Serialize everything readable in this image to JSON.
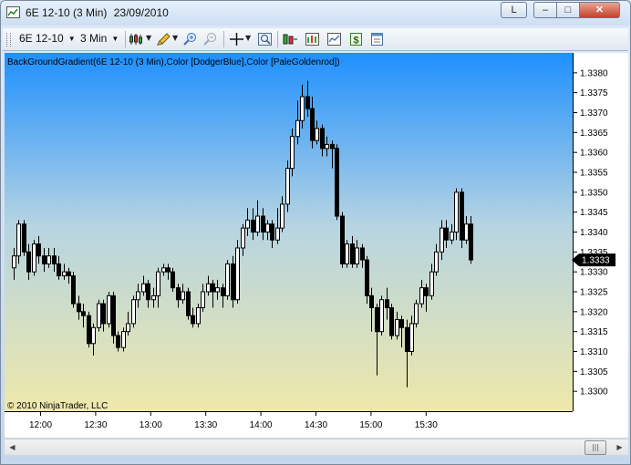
{
  "window": {
    "title_instrument": "6E 12-10",
    "title_period": "(3 Min)",
    "title_date": "23/09/2010",
    "btn_l": "L",
    "btn_min": "–",
    "btn_max": "□",
    "btn_close": "✕"
  },
  "toolbar": {
    "instrument": "6E 12-10",
    "period": "3 Min"
  },
  "chart": {
    "indicator_label": "BackGroundGradient(6E 12-10 (3 Min),Color [DodgerBlue],Color [PaleGoldenrod])",
    "copyright": "© 2010 NinjaTrader, LLC",
    "last_price_label": "1.3333",
    "gradient_top": "#1e90ff",
    "gradient_bottom": "#eee8aa"
  },
  "scrollbar": {
    "left_arrow": "◀",
    "right_arrow": "▶",
    "thumb_grip": "|||"
  },
  "chart_data": {
    "type": "candlestick",
    "ylim": [
      1.3295,
      1.3385
    ],
    "y_ticks": [
      "1.3380",
      "1.3375",
      "1.3370",
      "1.3365",
      "1.3360",
      "1.3355",
      "1.3350",
      "1.3345",
      "1.3340",
      "1.3335",
      "1.3330",
      "1.3325",
      "1.3320",
      "1.3315",
      "1.3310",
      "1.3305",
      "1.3300"
    ],
    "x_ticks": [
      "12:00",
      "12:30",
      "13:00",
      "13:30",
      "14:00",
      "14:30",
      "15:00",
      "15:30"
    ],
    "last_price": 1.3333,
    "candles": [
      [
        1.3331,
        1.3334,
        1.3328,
        1.3336
      ],
      [
        1.3334,
        1.3342,
        1.3332,
        1.3343
      ],
      [
        1.3342,
        1.3335,
        1.3334,
        1.3343
      ],
      [
        1.3335,
        1.333,
        1.3328,
        1.3337
      ],
      [
        1.333,
        1.3337,
        1.3329,
        1.3338
      ],
      [
        1.3337,
        1.3334,
        1.3332,
        1.3339
      ],
      [
        1.3334,
        1.3332,
        1.333,
        1.3336
      ],
      [
        1.3332,
        1.3334,
        1.3331,
        1.3336
      ],
      [
        1.3334,
        1.3332,
        1.333,
        1.3336
      ],
      [
        1.3332,
        1.3329,
        1.3328,
        1.3334
      ],
      [
        1.3329,
        1.333,
        1.3328,
        1.3332
      ],
      [
        1.333,
        1.3329,
        1.3327,
        1.3331
      ],
      [
        1.3329,
        1.3322,
        1.3321,
        1.333
      ],
      [
        1.3322,
        1.332,
        1.3318,
        1.3324
      ],
      [
        1.332,
        1.3319,
        1.3316,
        1.3322
      ],
      [
        1.3319,
        1.3312,
        1.3311,
        1.332
      ],
      [
        1.3312,
        1.3316,
        1.3309,
        1.3317
      ],
      [
        1.3316,
        1.3322,
        1.3315,
        1.3323
      ],
      [
        1.3322,
        1.3317,
        1.3315,
        1.3323
      ],
      [
        1.3317,
        1.3324,
        1.3316,
        1.3325
      ],
      [
        1.3324,
        1.3314,
        1.3312,
        1.3325
      ],
      [
        1.3314,
        1.3311,
        1.331,
        1.3315
      ],
      [
        1.3311,
        1.3315,
        1.331,
        1.3316
      ],
      [
        1.3315,
        1.3317,
        1.3314,
        1.332
      ],
      [
        1.3317,
        1.3323,
        1.3316,
        1.3324
      ],
      [
        1.3323,
        1.3325,
        1.3321,
        1.3327
      ],
      [
        1.3325,
        1.3327,
        1.3324,
        1.3329
      ],
      [
        1.3327,
        1.3323,
        1.3321,
        1.3328
      ],
      [
        1.3323,
        1.3324,
        1.3321,
        1.3326
      ],
      [
        1.3324,
        1.333,
        1.3321,
        1.3331
      ],
      [
        1.333,
        1.3331,
        1.3329,
        1.3332
      ],
      [
        1.3331,
        1.333,
        1.3328,
        1.3332
      ],
      [
        1.333,
        1.3326,
        1.3325,
        1.3331
      ],
      [
        1.3326,
        1.3323,
        1.3321,
        1.3327
      ],
      [
        1.3323,
        1.3325,
        1.3322,
        1.3327
      ],
      [
        1.3325,
        1.3319,
        1.3318,
        1.3326
      ],
      [
        1.3319,
        1.3317,
        1.3316,
        1.3321
      ],
      [
        1.3317,
        1.3321,
        1.3316,
        1.3322
      ],
      [
        1.3321,
        1.3325,
        1.332,
        1.3327
      ],
      [
        1.3325,
        1.3327,
        1.3324,
        1.3329
      ],
      [
        1.3327,
        1.3325,
        1.3321,
        1.3328
      ],
      [
        1.3325,
        1.3326,
        1.3323,
        1.3328
      ],
      [
        1.3326,
        1.3324,
        1.3321,
        1.3327
      ],
      [
        1.3324,
        1.3332,
        1.3323,
        1.3333
      ],
      [
        1.3332,
        1.3323,
        1.3321,
        1.3334
      ],
      [
        1.3323,
        1.3336,
        1.3322,
        1.3338
      ],
      [
        1.3336,
        1.3341,
        1.3334,
        1.3342
      ],
      [
        1.3341,
        1.3343,
        1.3339,
        1.3346
      ],
      [
        1.3343,
        1.334,
        1.3338,
        1.3346
      ],
      [
        1.334,
        1.3344,
        1.3339,
        1.3348
      ],
      [
        1.3344,
        1.334,
        1.3338,
        1.3346
      ],
      [
        1.334,
        1.3342,
        1.3338,
        1.3343
      ],
      [
        1.3342,
        1.3338,
        1.3336,
        1.3343
      ],
      [
        1.3338,
        1.3341,
        1.3337,
        1.3346
      ],
      [
        1.3341,
        1.3347,
        1.334,
        1.3349
      ],
      [
        1.3347,
        1.3356,
        1.3345,
        1.3358
      ],
      [
        1.3356,
        1.3364,
        1.3354,
        1.3366
      ],
      [
        1.3364,
        1.3368,
        1.3362,
        1.3373
      ],
      [
        1.3368,
        1.3374,
        1.3366,
        1.3377
      ],
      [
        1.3374,
        1.3371,
        1.3369,
        1.3378
      ],
      [
        1.3371,
        1.3363,
        1.3361,
        1.3374
      ],
      [
        1.3363,
        1.3366,
        1.3362,
        1.3368
      ],
      [
        1.3366,
        1.3361,
        1.3359,
        1.3367
      ],
      [
        1.3361,
        1.3362,
        1.3359,
        1.3364
      ],
      [
        1.3362,
        1.3361,
        1.3356,
        1.3363
      ],
      [
        1.3361,
        1.3344,
        1.3343,
        1.3362
      ],
      [
        1.3344,
        1.3332,
        1.3331,
        1.3345
      ],
      [
        1.3332,
        1.3337,
        1.3331,
        1.3338
      ],
      [
        1.3337,
        1.3332,
        1.3331,
        1.3339
      ],
      [
        1.3332,
        1.3336,
        1.3331,
        1.3338
      ],
      [
        1.3336,
        1.3333,
        1.3331,
        1.3337
      ],
      [
        1.3333,
        1.3324,
        1.3322,
        1.3334
      ],
      [
        1.3324,
        1.3321,
        1.3315,
        1.3326
      ],
      [
        1.3321,
        1.3315,
        1.3304,
        1.3322
      ],
      [
        1.3315,
        1.3323,
        1.3314,
        1.3324
      ],
      [
        1.3323,
        1.3321,
        1.3318,
        1.3326
      ],
      [
        1.3321,
        1.3314,
        1.3313,
        1.3322
      ],
      [
        1.3314,
        1.3318,
        1.3313,
        1.332
      ],
      [
        1.3318,
        1.3316,
        1.3311,
        1.3319
      ],
      [
        1.3316,
        1.331,
        1.3301,
        1.3318
      ],
      [
        1.331,
        1.3317,
        1.3309,
        1.3319
      ],
      [
        1.3317,
        1.3322,
        1.3316,
        1.3323
      ],
      [
        1.3322,
        1.3326,
        1.3321,
        1.3328
      ],
      [
        1.3326,
        1.3324,
        1.332,
        1.3327
      ],
      [
        1.3324,
        1.333,
        1.3323,
        1.3332
      ],
      [
        1.333,
        1.3335,
        1.3329,
        1.3337
      ],
      [
        1.3335,
        1.3341,
        1.3333,
        1.3343
      ],
      [
        1.3341,
        1.3338,
        1.3336,
        1.3343
      ],
      [
        1.3338,
        1.334,
        1.3337,
        1.3342
      ],
      [
        1.334,
        1.335,
        1.3338,
        1.3351
      ],
      [
        1.335,
        1.3338,
        1.3336,
        1.3351
      ],
      [
        1.3338,
        1.3342,
        1.3337,
        1.3344
      ],
      [
        1.3342,
        1.3333,
        1.3332,
        1.3344
      ]
    ]
  }
}
